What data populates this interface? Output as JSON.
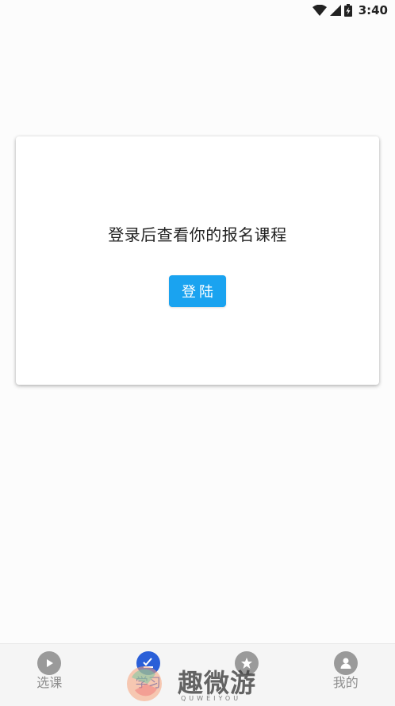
{
  "status_bar": {
    "time": "3:40",
    "icons": [
      "wifi-icon",
      "cell-signal-icon",
      "battery-charging-icon"
    ]
  },
  "login_card": {
    "message": "登录后查看你的报名课程",
    "login_button": "登陆"
  },
  "bottom_nav": {
    "active_index": 1,
    "accent_color": "#2a5fd8",
    "items": [
      {
        "label": "选课",
        "icon": "play-icon"
      },
      {
        "label": "学习",
        "icon": "pen-check-icon"
      },
      {
        "label": "",
        "icon": "star-icon"
      },
      {
        "label": "我的",
        "icon": "user-icon"
      }
    ]
  },
  "watermark": {
    "text": "趣微游",
    "subtext": "QUWEIYOU"
  }
}
